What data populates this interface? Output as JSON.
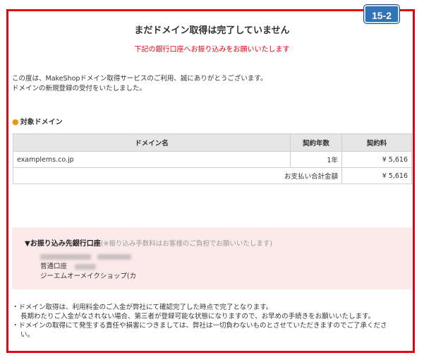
{
  "badge": "15-2",
  "title": "まだドメイン取得は完了していません",
  "subtitle": "下記の銀行口座へお振り込みをお願いいたします",
  "intro": [
    "この度は、MakeShopドメイン取得サービスのご利用、誠にありがとうございます。",
    "ドメインの新規登録の受付をいたしました。"
  ],
  "section_label": "対象ドメイン",
  "table": {
    "headers": [
      "ドメイン名",
      "契約年数",
      "契約料"
    ],
    "rows": [
      {
        "domain": "examplems.co.jp",
        "years": "1年",
        "fee": "¥ 5,616"
      }
    ],
    "total_label": "お支払い合計金額",
    "total_value": "¥ 5,616"
  },
  "bank": {
    "heading": "▼お振り込み先銀行口座",
    "heading_note": "(※振り込み手数料はお客様のご負担でお願いいたします)",
    "account_type": "普通口座",
    "account_name": "ジーエムオーメイクショップ(カ"
  },
  "notes": [
    "・ドメイン取得は、利用料金のご入金が弊社にて確認完了した時点で完了となります。",
    "長期わたりご入金がなされない場合、第三者が登録可能な状態になりますので、お早めの手続きをお願いいたします。",
    "・ドメインの取得にて発生する責任や損害につきましては、弊社は一切負わないものとさせていただきますのでご了承くださ",
    "い。"
  ]
}
